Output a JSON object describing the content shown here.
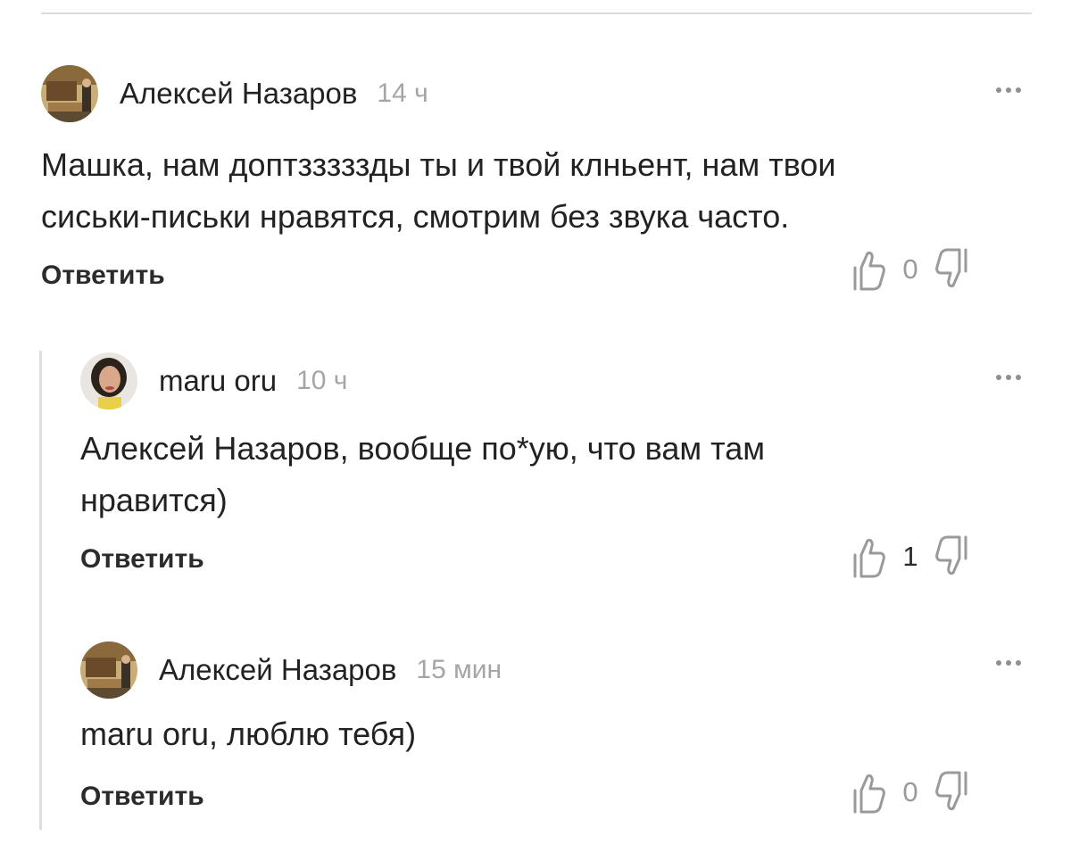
{
  "comments": [
    {
      "author": "Алексей Назаров",
      "time": "14 ч",
      "text_line1": "Машка, нам доптзззззды ты и твой клньент, нам твои",
      "text_line2": "сиськи-письки нравятся, смотрим без звука часто.",
      "reply_label": "Ответить",
      "likes": "0",
      "avatar_icon": "painting-avatar"
    },
    {
      "author": "maru oru",
      "time": "10 ч",
      "text_line1": "Алексей Назаров, вообще по*ую, что вам там",
      "text_line2": "нравится)",
      "reply_label": "Ответить",
      "likes": "1",
      "avatar_icon": "woman-portrait-avatar"
    },
    {
      "author": "Алексей Назаров",
      "time": "15 мин",
      "text_line1": "maru oru, люблю тебя)",
      "reply_label": "Ответить",
      "likes": "0",
      "avatar_icon": "painting-avatar"
    }
  ],
  "colors": {
    "divider": "#dcdcdc",
    "muted_text": "#a5a5a5",
    "icon": "#9a9a9a"
  }
}
